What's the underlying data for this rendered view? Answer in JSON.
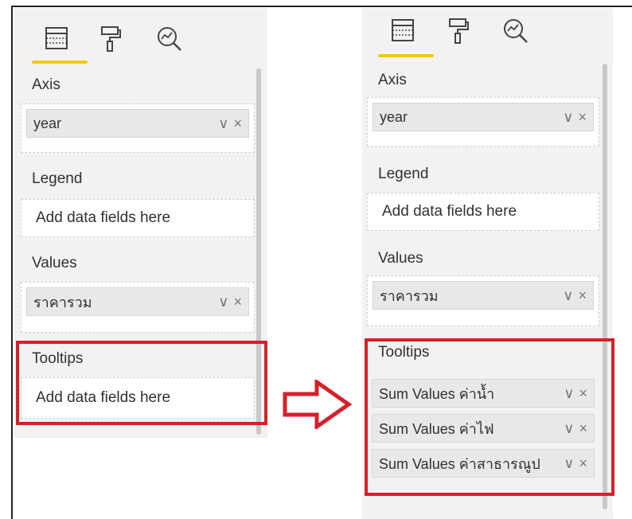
{
  "colors": {
    "accent": "#f2c811",
    "highlight": "#d6202a",
    "panel": "#f3f2f1",
    "chip": "#e8e8e8"
  },
  "icons": [
    "fields-icon",
    "format-paint-roller-icon",
    "analytics-magnifier-icon",
    "chevron-down-icon",
    "close-icon",
    "arrow-right-icon"
  ],
  "left_panel": {
    "axis_label": "Axis",
    "axis_field": "year",
    "legend_label": "Legend",
    "legend_placeholder": "Add data fields here",
    "values_label": "Values",
    "values_field": "ราคารวม",
    "tooltips_label": "Tooltips",
    "tooltips_placeholder": "Add data fields here"
  },
  "right_panel": {
    "axis_label": "Axis",
    "axis_field": "year",
    "legend_label": "Legend",
    "legend_placeholder": "Add data fields here",
    "values_label": "Values",
    "values_field": "ราคารวม",
    "tooltips_label": "Tooltips",
    "tooltip_fields": [
      "Sum Values ค่าน้ำ",
      "Sum Values ค่าไฟ",
      "Sum Values ค่าสาธารณูป"
    ]
  },
  "chip_actions": {
    "expand": "∨",
    "remove": "×"
  }
}
